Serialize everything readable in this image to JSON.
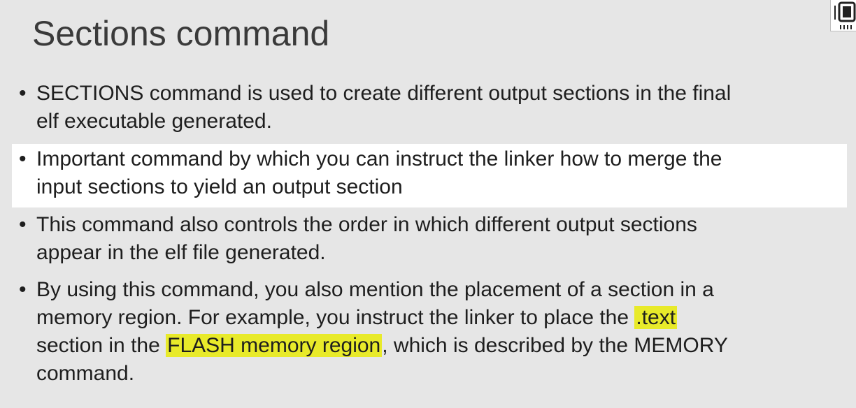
{
  "slide": {
    "title": "Sections command",
    "bullets": [
      {
        "line1": "SECTIONS command is used to create different output sections in the final",
        "line2": "elf executable generated."
      },
      {
        "line1": "Important command by which you can instruct the linker how to merge the",
        "line2": "input sections to yield an output section"
      },
      {
        "line1": "This command also controls the order in which different output sections",
        "line2": "appear in the elf file generated."
      },
      {
        "line1": "By using this command, you also mention the placement of a section in a",
        "line2_pre": "memory region. For example, you instruct the linker to place the ",
        "line2_hl": ".text",
        "line3_pre": "section in the ",
        "line3_hl": "FLASH memory region",
        "line3_post": ", which is described by the MEMORY",
        "line4": "command."
      }
    ],
    "bullet_glyph": "•"
  },
  "colors": {
    "background": "#e6e6e6",
    "highlight_box": "#ffffff",
    "text_highlight": "#e8ea2a",
    "text": "#1e1e1e"
  },
  "icons": {
    "corner": "chip-icon"
  }
}
